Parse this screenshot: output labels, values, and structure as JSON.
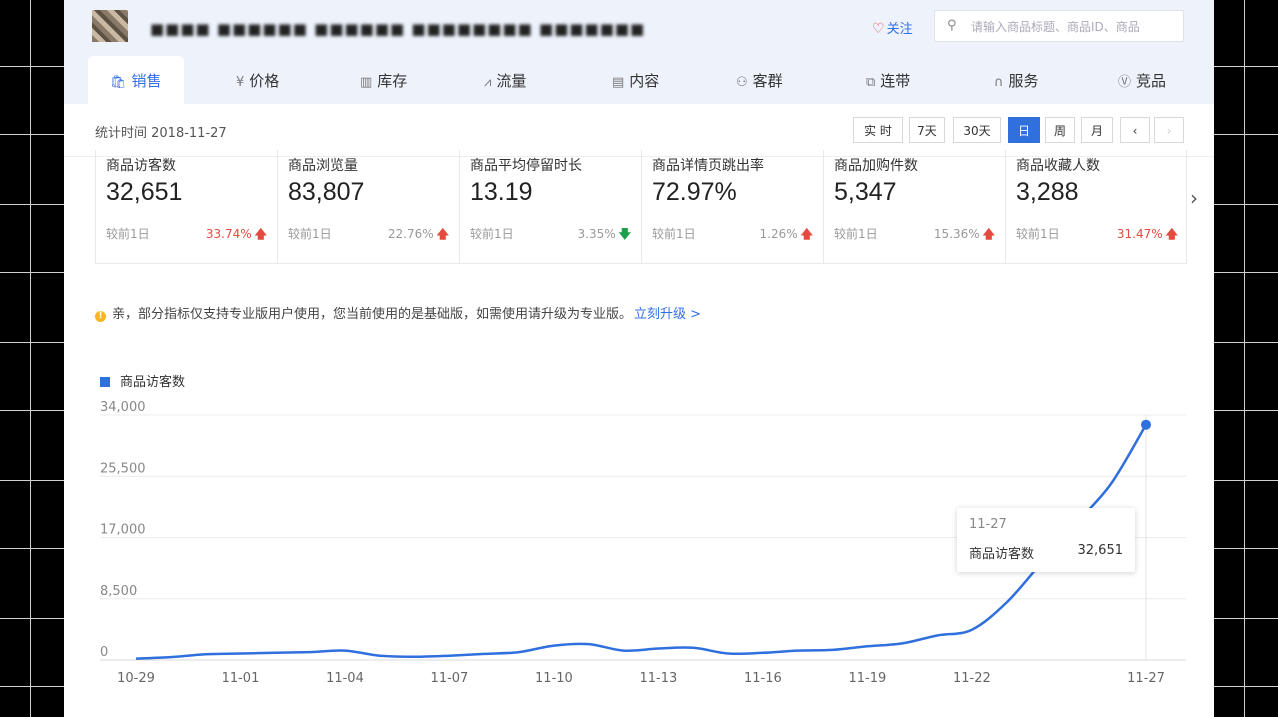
{
  "header": {
    "title": "■■■■ ■■■■■■ ■■■■■■ ■■■■■■■■ ■■■■■■■",
    "follow_label": "关注",
    "search_placeholder": "请输入商品标题、商品ID、商品"
  },
  "tabs": [
    {
      "label": "销售",
      "icon": "bag-icon",
      "glyph": "🛍",
      "active": true
    },
    {
      "label": "价格",
      "icon": "yen-icon",
      "glyph": "¥",
      "active": false
    },
    {
      "label": "库存",
      "icon": "warehouse-icon",
      "glyph": "▥",
      "active": false
    },
    {
      "label": "流量",
      "icon": "trend-icon",
      "glyph": "⩘",
      "active": false
    },
    {
      "label": "内容",
      "icon": "document-icon",
      "glyph": "▤",
      "active": false
    },
    {
      "label": "客群",
      "icon": "people-icon",
      "glyph": "⚇",
      "active": false
    },
    {
      "label": "连带",
      "icon": "link-icon",
      "glyph": "⧉",
      "active": false
    },
    {
      "label": "服务",
      "icon": "headset-icon",
      "glyph": "∩",
      "active": false
    },
    {
      "label": "竞品",
      "icon": "vs-icon",
      "glyph": "Ⓥ",
      "active": false
    }
  ],
  "stat": {
    "date_label": "统计时间 2018-11-27",
    "ranges": [
      {
        "label": "实 时",
        "active": false
      },
      {
        "label": "7天",
        "active": false
      },
      {
        "label": "30天",
        "active": false
      },
      {
        "label": "日",
        "active": true
      },
      {
        "label": "周",
        "active": false
      },
      {
        "label": "月",
        "active": false
      },
      {
        "label": "‹",
        "active": false
      },
      {
        "label": "›",
        "active": false,
        "disabled": true
      }
    ]
  },
  "metrics": [
    {
      "label": "商品访客数",
      "value": "32,651",
      "compare": "较前1日",
      "pct": "33.74%",
      "direction": "up"
    },
    {
      "label": "商品浏览量",
      "value": "83,807",
      "compare": "较前1日",
      "pct": "22.76%",
      "direction": "up"
    },
    {
      "label": "商品平均停留时长",
      "value": "13.19",
      "compare": "较前1日",
      "pct": "3.35%",
      "direction": "down"
    },
    {
      "label": "商品详情页跳出率",
      "value": "72.97%",
      "compare": "较前1日",
      "pct": "1.26%",
      "direction": "up"
    },
    {
      "label": "商品加购件数",
      "value": "5,347",
      "compare": "较前1日",
      "pct": "15.36%",
      "direction": "up"
    },
    {
      "label": "商品收藏人数",
      "value": "3,288",
      "compare": "较前1日",
      "pct": "31.47%",
      "direction": "up"
    }
  ],
  "notice": {
    "text": "亲，部分指标仅支持专业版用户使用，您当前使用的是基础版，如需使用请升级为专业版。",
    "link": "立刻升级 >"
  },
  "chart_data": {
    "type": "line",
    "title": "",
    "xlabel": "",
    "ylabel": "",
    "legend": "top-left",
    "grid": true,
    "ylim": [
      0,
      34000
    ],
    "yticks": [
      "34,000",
      "25,500",
      "17,000",
      "8,500",
      "0"
    ],
    "x": [
      "10-29",
      "10-30",
      "10-31",
      "11-01",
      "11-02",
      "11-03",
      "11-04",
      "11-05",
      "11-06",
      "11-07",
      "11-08",
      "11-09",
      "11-10",
      "11-11",
      "11-12",
      "11-13",
      "11-14",
      "11-15",
      "11-16",
      "11-17",
      "11-18",
      "11-19",
      "11-20",
      "11-21",
      "11-22",
      "11-23",
      "11-24",
      "11-25",
      "11-26",
      "11-27"
    ],
    "xtick_labels": [
      "10-29",
      "11-01",
      "11-04",
      "11-07",
      "11-10",
      "11-13",
      "11-16",
      "11-19",
      "11-22",
      "11-27"
    ],
    "series": [
      {
        "name": "商品访客数",
        "color": "#2f6fde",
        "values": [
          200,
          400,
          800,
          900,
          1000,
          1100,
          1300,
          600,
          450,
          600,
          850,
          1100,
          2000,
          2200,
          1300,
          1600,
          1700,
          900,
          1000,
          1300,
          1400,
          1900,
          2300,
          3400,
          4200,
          8000,
          13500,
          19000,
          24500,
          32651
        ]
      }
    ],
    "tooltip": {
      "x": "11-27",
      "series": "商品访客数",
      "value": "32,651"
    }
  }
}
